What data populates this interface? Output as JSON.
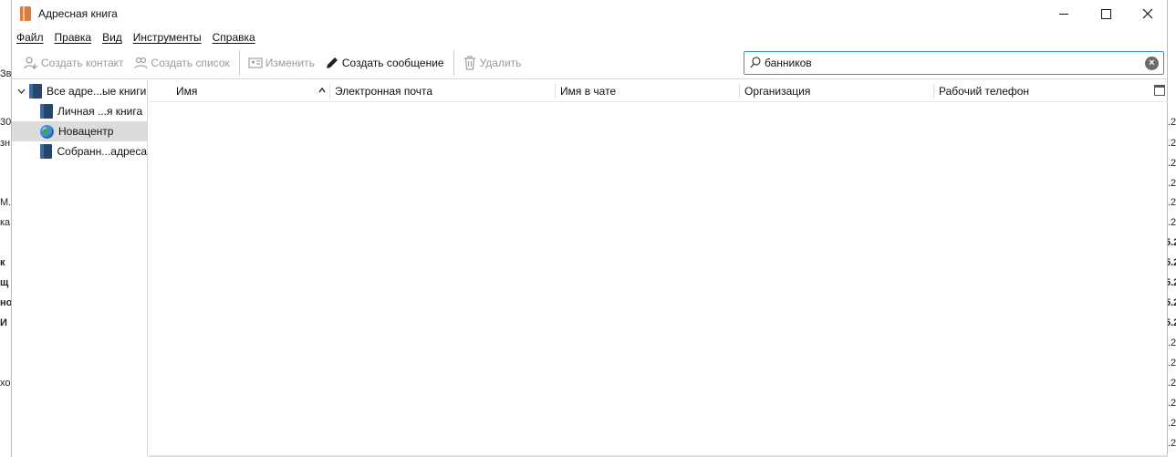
{
  "window": {
    "title": "Адресная книга",
    "controls": [
      "minimize",
      "maximize",
      "close"
    ]
  },
  "menu": [
    "Файл",
    "Правка",
    "Вид",
    "Инструменты",
    "Справка"
  ],
  "toolbar": {
    "new_contact": "Создать контакт",
    "new_list": "Создать список",
    "edit": "Изменить",
    "write": "Создать сообщение",
    "delete": "Удалить"
  },
  "search": {
    "value": "банников"
  },
  "tree": [
    {
      "label": "Все адре...ые книги",
      "expanded": true
    },
    {
      "label": "Личная ...я книга"
    },
    {
      "label": "Новацентр",
      "selected": true
    },
    {
      "label": "Собранн...адреса"
    }
  ],
  "columns": [
    "Имя",
    "Электронная почта",
    "Имя в чате",
    "Организация",
    "Рабочий телефон"
  ],
  "background_left": [
    "Зв",
    "30",
    "зн",
    "М.",
    "ка",
    "к",
    "щ",
    "но",
    "И",
    "хо"
  ],
  "background_right": [
    ".2",
    ".2",
    ".2",
    ".2",
    ".2",
    ".2",
    "5.2",
    "5.2",
    "5.2",
    "5.2",
    "5.2",
    ".2",
    ".2",
    ".2",
    ".2",
    ".2",
    ".2"
  ],
  "colors": {
    "search_border": "#3c8fd6",
    "selected_row": "#dcdcdc",
    "disabled_text": "#9a9a9a"
  }
}
